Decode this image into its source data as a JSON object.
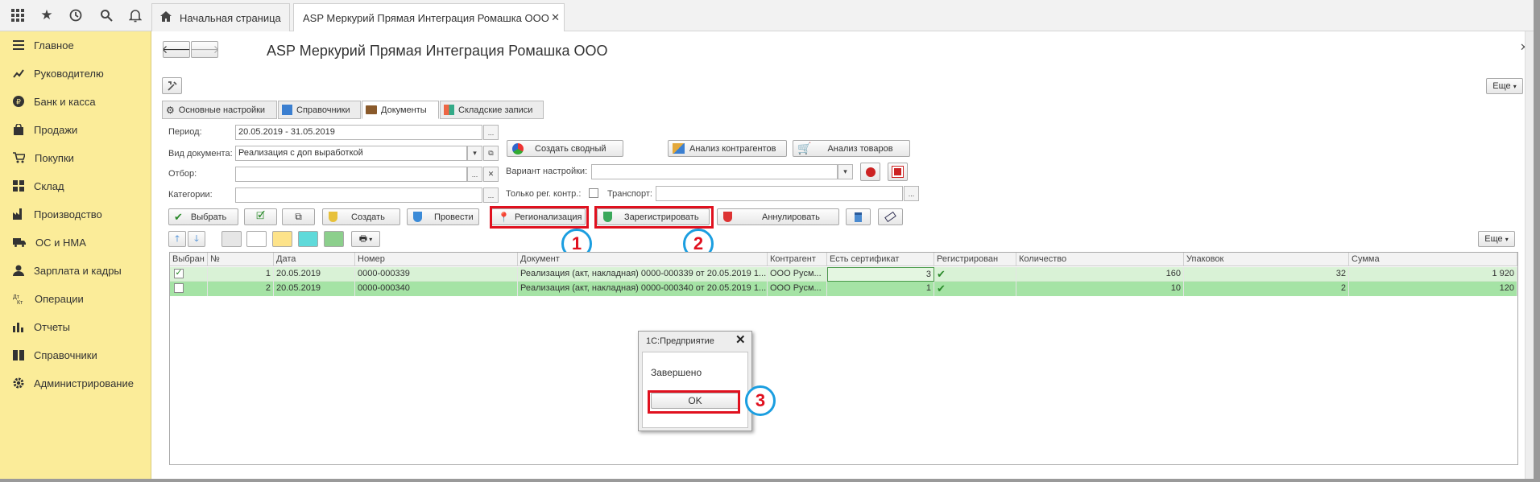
{
  "tabs": {
    "home": "Начальная страница",
    "active": "ASP Меркурий Прямая Интеграция Ромашка ООО"
  },
  "sidebar": [
    {
      "label": "Главное",
      "icon": "menu-lines-icon"
    },
    {
      "label": "Руководителю",
      "icon": "chart-line-icon"
    },
    {
      "label": "Банк и касса",
      "icon": "coin-icon"
    },
    {
      "label": "Продажи",
      "icon": "bag-icon"
    },
    {
      "label": "Покупки",
      "icon": "cart-icon"
    },
    {
      "label": "Склад",
      "icon": "warehouse-grid-icon"
    },
    {
      "label": "Производство",
      "icon": "factory-icon"
    },
    {
      "label": "ОС и НМА",
      "icon": "truck-icon"
    },
    {
      "label": "Зарплата и кадры",
      "icon": "person-icon"
    },
    {
      "label": "Операции",
      "icon": "debit-credit-icon"
    },
    {
      "label": "Отчеты",
      "icon": "bar-chart-icon"
    },
    {
      "label": "Справочники",
      "icon": "book-icon"
    },
    {
      "label": "Администрирование",
      "icon": "gear-icon"
    }
  ],
  "form": {
    "title": "ASP Меркурий Прямая Интеграция Ромашка ООО",
    "more": "Еще",
    "form_tabs": [
      "Основные настройки",
      "Справочники",
      "Документы",
      "Складские записи"
    ],
    "period_label": "Период:",
    "period_value": "20.05.2019 - 31.05.2019",
    "doctype_label": "Вид документа:",
    "doctype_value": "Реализация с доп выработкой",
    "filter_label": "Отбор:",
    "category_label": "Категории:",
    "create_summary": "Создать сводный",
    "analysis_contractors": "Анализ контрагентов",
    "analysis_goods": "Анализ товаров",
    "variant_label": "Вариант настройки:",
    "only_reg_label": "Только рег. контр.:",
    "transport_label": "Транспорт:",
    "select_btn": "Выбрать",
    "create_btn": "Создать",
    "post_btn": "Провести",
    "regionalize_btn": "Регионализация",
    "register_btn": "Зарегистрировать",
    "cancel_btn": "Аннулировать"
  },
  "callouts": [
    "1",
    "2",
    "3"
  ],
  "table": {
    "more": "Еще",
    "headers": [
      "Выбран",
      "№",
      "Дата",
      "Номер",
      "Документ",
      "Контрагент",
      "Есть сертификат",
      "Регистрирован",
      "Количество",
      "Упаковок",
      "Сумма"
    ],
    "rows": [
      {
        "checked": true,
        "n": "1",
        "date": "20.05.2019",
        "number": "0000-000339",
        "doc": "Реализация (акт, накладная) 0000-000339 от 20.05.2019 1...",
        "contractor": "ООО Русм...",
        "cert": "3",
        "registered": true,
        "qty": "160",
        "packs": "32",
        "sum": "1 920"
      },
      {
        "checked": false,
        "n": "2",
        "date": "20.05.2019",
        "number": "0000-000340",
        "doc": "Реализация (акт, накладная) 0000-000340 от 20.05.2019 1...",
        "contractor": "ООО Русм...",
        "cert": "1",
        "registered": true,
        "qty": "10",
        "packs": "2",
        "sum": "120"
      }
    ]
  },
  "dialog": {
    "title": "1С:Предприятие",
    "message": "Завершено",
    "ok": "OK"
  },
  "colors": {
    "sidebar": "#fbec99",
    "row_green": "#d9f2d6",
    "row_selected": "#a5e3a5",
    "highlight": "#e0111f",
    "callout": "#1b9ee0"
  }
}
